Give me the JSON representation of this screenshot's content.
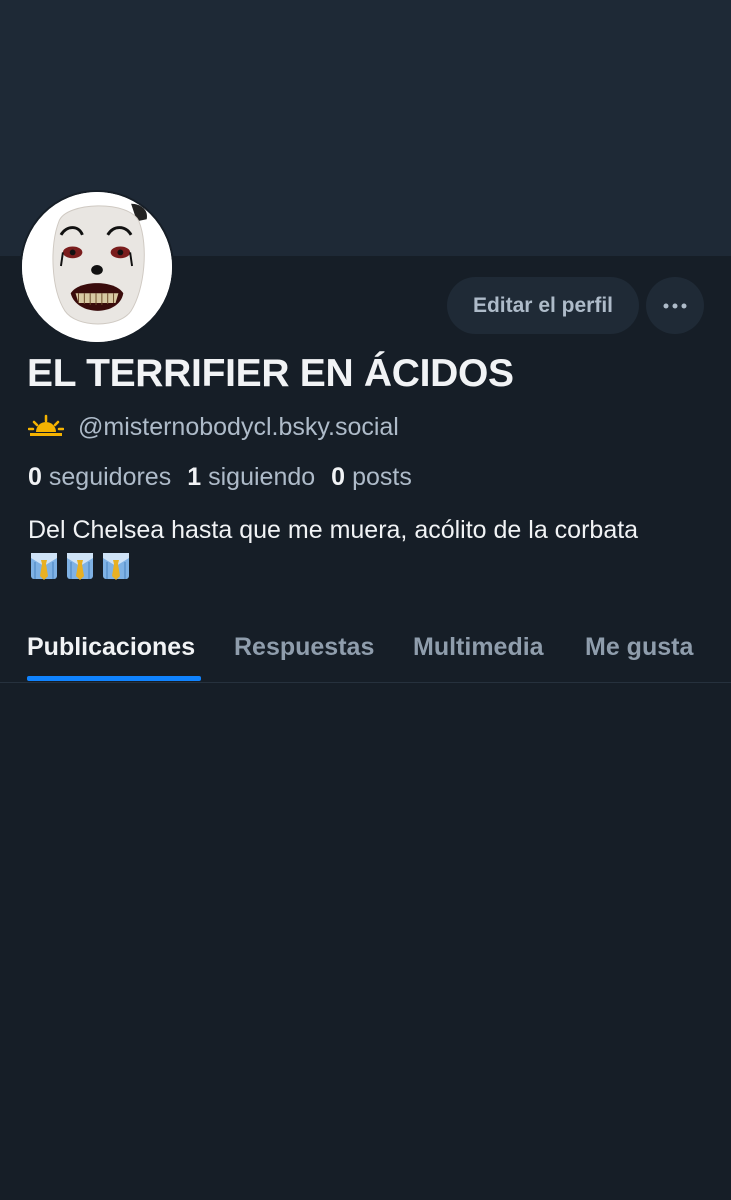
{
  "profile": {
    "display_name": "EL TERRIFIER EN ÁCIDOS",
    "handle": "@misternobodycl.bsky.social",
    "bio": "Del Chelsea hasta que me muera, acólito de la corbata",
    "bio_emojis": [
      "necktie-shirt-emoji",
      "necktie-shirt-emoji",
      "necktie-shirt-emoji"
    ]
  },
  "actions": {
    "edit_label": "Editar el perfil",
    "more_label": "···"
  },
  "stats": {
    "followers_count": "0",
    "followers_label": "seguidores",
    "following_count": "1",
    "following_label": "siguiendo",
    "posts_count": "0",
    "posts_label": "posts"
  },
  "tabs": [
    {
      "label": "Publicaciones",
      "active": true
    },
    {
      "label": "Respuestas",
      "active": false
    },
    {
      "label": "Multimedia",
      "active": false
    },
    {
      "label": "Me gusta",
      "active": false
    }
  ],
  "colors": {
    "background": "#161e27",
    "banner": "#1e2936",
    "accent": "#1083fe",
    "text_primary": "#f1f3f5",
    "text_secondary": "#aebbc9"
  },
  "icons": {
    "handle_icon": "sunrise-icon",
    "avatar": "clown-mask-avatar"
  }
}
